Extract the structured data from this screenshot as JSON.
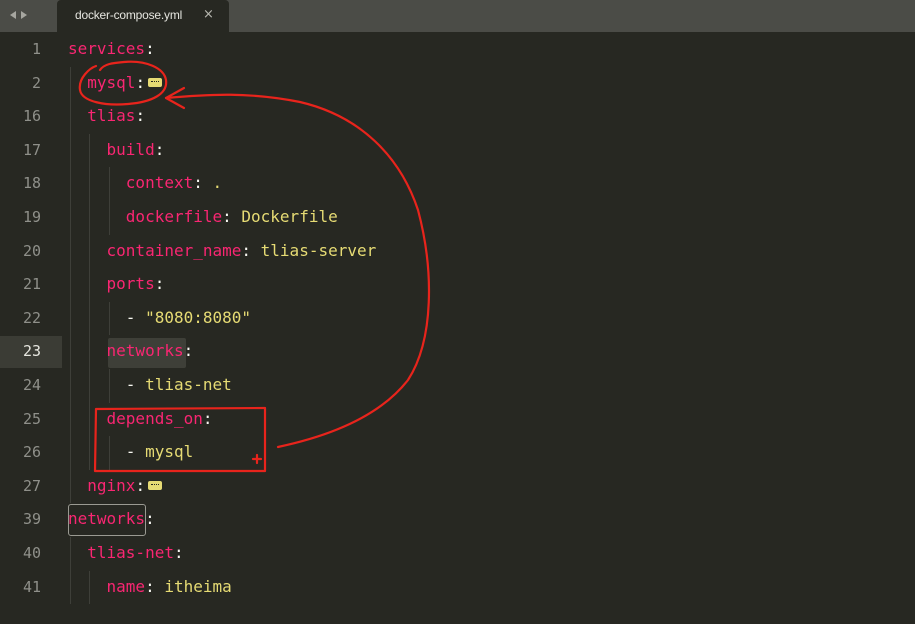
{
  "tab": {
    "filename": "docker-compose.yml",
    "close_glyph": "×"
  },
  "nav": {
    "back_icon": "triangle-left",
    "forward_icon": "triangle-right"
  },
  "colors": {
    "background": "#272822",
    "key": "#f92672",
    "string": "#e6db74",
    "plain": "#f8f8f2",
    "line_number": "#8f908a",
    "annotation": "#e8241c"
  },
  "editor": {
    "current_line": "23",
    "lines": [
      {
        "num": "1",
        "indent": "",
        "key": "services",
        "sep": ":",
        "value": "",
        "fold": false
      },
      {
        "num": "2",
        "indent": "  ",
        "key": "mysql",
        "sep": ":",
        "value": "",
        "fold": true
      },
      {
        "num": "16",
        "indent": "  ",
        "key": "tlias",
        "sep": ":",
        "value": "",
        "fold": false
      },
      {
        "num": "17",
        "indent": "    ",
        "key": "build",
        "sep": ":",
        "value": "",
        "fold": false
      },
      {
        "num": "18",
        "indent": "      ",
        "key": "context",
        "sep": ": ",
        "value": ".",
        "fold": false
      },
      {
        "num": "19",
        "indent": "      ",
        "key": "dockerfile",
        "sep": ": ",
        "value": "Dockerfile",
        "fold": false
      },
      {
        "num": "20",
        "indent": "    ",
        "key": "container_name",
        "sep": ": ",
        "value": "tlias-server",
        "fold": false
      },
      {
        "num": "21",
        "indent": "    ",
        "key": "ports",
        "sep": ":",
        "value": "",
        "fold": false
      },
      {
        "num": "22",
        "indent": "      ",
        "key": "",
        "sep": "- ",
        "value": "\"8080:8080\"",
        "fold": false
      },
      {
        "num": "23",
        "indent": "    ",
        "key": "networks",
        "sep": ":",
        "value": "",
        "fold": false
      },
      {
        "num": "24",
        "indent": "      ",
        "key": "",
        "sep": "- ",
        "value": "tlias-net",
        "fold": false
      },
      {
        "num": "25",
        "indent": "    ",
        "key": "depends_on",
        "sep": ":",
        "value": "",
        "fold": false
      },
      {
        "num": "26",
        "indent": "      ",
        "key": "",
        "sep": "- ",
        "value": "mysql",
        "fold": false
      },
      {
        "num": "27",
        "indent": "  ",
        "key": "nginx",
        "sep": ":",
        "value": "",
        "fold": true
      },
      {
        "num": "39",
        "indent": "",
        "key": "networks",
        "sep": ":",
        "value": "",
        "fold": false
      },
      {
        "num": "40",
        "indent": "  ",
        "key": "tlias-net",
        "sep": ":",
        "value": "",
        "fold": false
      },
      {
        "num": "41",
        "indent": "    ",
        "key": "name",
        "sep": ": ",
        "value": "itheima",
        "fold": false
      }
    ]
  }
}
